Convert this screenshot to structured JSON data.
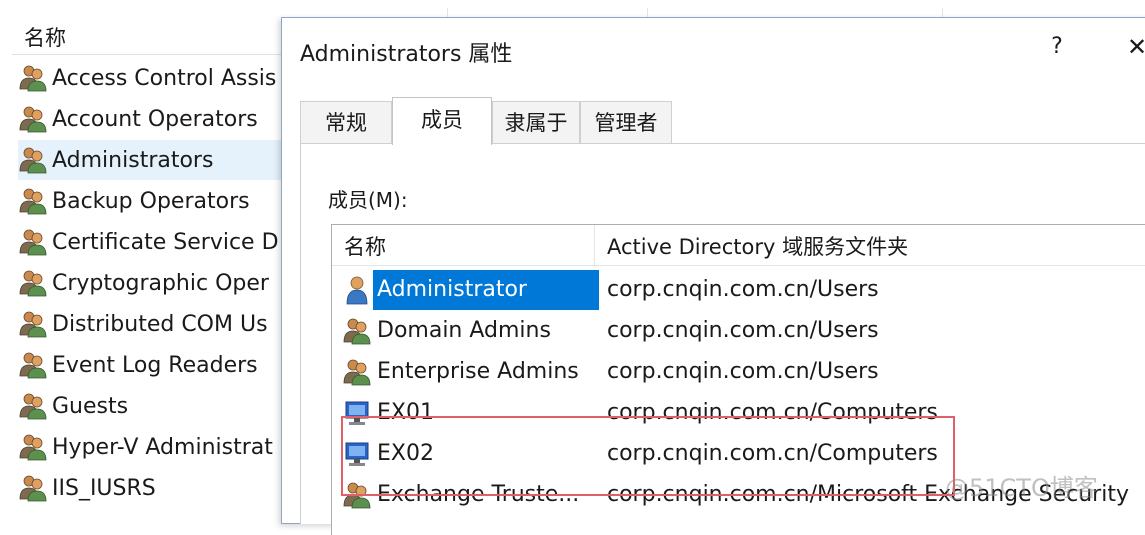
{
  "background_list": {
    "header_name": "名称",
    "groups": [
      {
        "label": "Access Control Assis",
        "selected": false
      },
      {
        "label": "Account Operators",
        "selected": false
      },
      {
        "label": "Administrators",
        "selected": true
      },
      {
        "label": "Backup Operators",
        "selected": false
      },
      {
        "label": "Certificate Service D",
        "selected": false
      },
      {
        "label": "Cryptographic Oper",
        "selected": false
      },
      {
        "label": "Distributed COM Us",
        "selected": false
      },
      {
        "label": "Event Log Readers",
        "selected": false
      },
      {
        "label": "Guests",
        "selected": false
      },
      {
        "label": "Hyper-V Administrat",
        "selected": false
      },
      {
        "label": "IIS_IUSRS",
        "selected": false
      }
    ]
  },
  "dialog": {
    "title": "Administrators 属性",
    "help": "?",
    "close": "✕",
    "tabs": [
      {
        "label": "常规",
        "active": false
      },
      {
        "label": "成员",
        "active": true
      },
      {
        "label": "隶属于",
        "active": false
      },
      {
        "label": "管理者",
        "active": false
      }
    ],
    "members_label": "成员(M):",
    "columns": {
      "name": "名称",
      "folder": "Active Directory 域服务文件夹"
    },
    "members": [
      {
        "name": "Administrator",
        "folder": "corp.cnqin.com.cn/Users",
        "icon": "user-icon",
        "selected": true
      },
      {
        "name": "Domain Admins",
        "folder": "corp.cnqin.com.cn/Users",
        "icon": "group-icon",
        "selected": false
      },
      {
        "name": "Enterprise Admins",
        "folder": "corp.cnqin.com.cn/Users",
        "icon": "group-icon",
        "selected": false
      },
      {
        "name": "EX01",
        "folder": "corp.cnqin.com.cn/Computers",
        "icon": "computer-icon",
        "selected": false
      },
      {
        "name": "EX02",
        "folder": "corp.cnqin.com.cn/Computers",
        "icon": "computer-icon",
        "selected": false
      },
      {
        "name": "Exchange Truste...",
        "folder": "corp.cnqin.com.cn/Microsoft Exchange Security",
        "icon": "group-icon",
        "selected": false
      }
    ]
  },
  "watermark": "@51CTO博客",
  "colors": {
    "selection": "#0078d7",
    "highlight_box": "#e0606a",
    "list_selected": "#e5f1fb"
  }
}
